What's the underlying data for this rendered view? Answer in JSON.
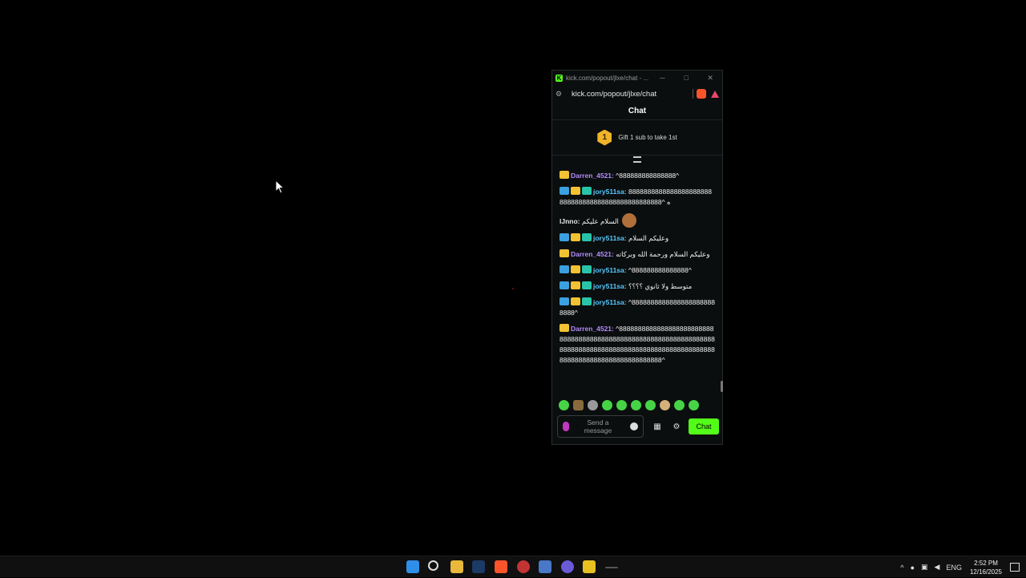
{
  "window": {
    "title": "kick.com/popout/jlxe/chat - ...",
    "url": "kick.com/popout/jlxe/chat",
    "controls": {
      "minimize": "─",
      "maximize": "□",
      "close": "✕"
    }
  },
  "chat": {
    "header": "Chat",
    "gift_badge": "1",
    "gift_text": "Gift 1 sub to take 1st",
    "messages": [
      {
        "user": "Darren_4521",
        "color": "#b38bfa",
        "badges": [
          "crown"
        ],
        "text": "^888888888888888^"
      },
      {
        "user": "jory511sa",
        "color": "#56c8ff",
        "badges": [
          "pick",
          "crown",
          "gift"
        ],
        "text": "8888888888888888888888888888888888888888888888888^ ه"
      },
      {
        "user": "lJnno",
        "color": "#e6e6e6",
        "badges": [],
        "text": "السلام عليكم",
        "emoji": "cookie"
      },
      {
        "user": "jory511sa",
        "color": "#56c8ff",
        "badges": [
          "pick",
          "crown",
          "gift"
        ],
        "text": "وعليكم السلام"
      },
      {
        "user": "Darren_4521",
        "color": "#b38bfa",
        "badges": [
          "crown"
        ],
        "text": "وعليكم السلام ورحمة الله وبركاته"
      },
      {
        "user": "jory511sa",
        "color": "#56c8ff",
        "badges": [
          "pick",
          "crown",
          "gift"
        ],
        "text": "^888888888888888^"
      },
      {
        "user": "jory511sa",
        "color": "#56c8ff",
        "badges": [
          "pick",
          "crown",
          "gift"
        ],
        "text": "متوسط ولا ثانوي ؟؟؟؟"
      },
      {
        "user": "jory511sa",
        "color": "#56c8ff",
        "badges": [
          "pick",
          "crown",
          "gift"
        ],
        "text": "^88888888888888888888888888^"
      },
      {
        "user": "Darren_4521",
        "color": "#b38bfa",
        "badges": [
          "crown"
        ],
        "text": "^88888888888888888888888888888888888888888888888888888888888888888888888888888888888888888888888888888888888888888888888888888888888888^"
      }
    ],
    "input_placeholder": "Send a message",
    "send_label": "Chat",
    "accent": "#53fc18"
  },
  "taskbar": {
    "time": "2:52 PM",
    "date": "12/16/2025",
    "language": "ENG"
  }
}
